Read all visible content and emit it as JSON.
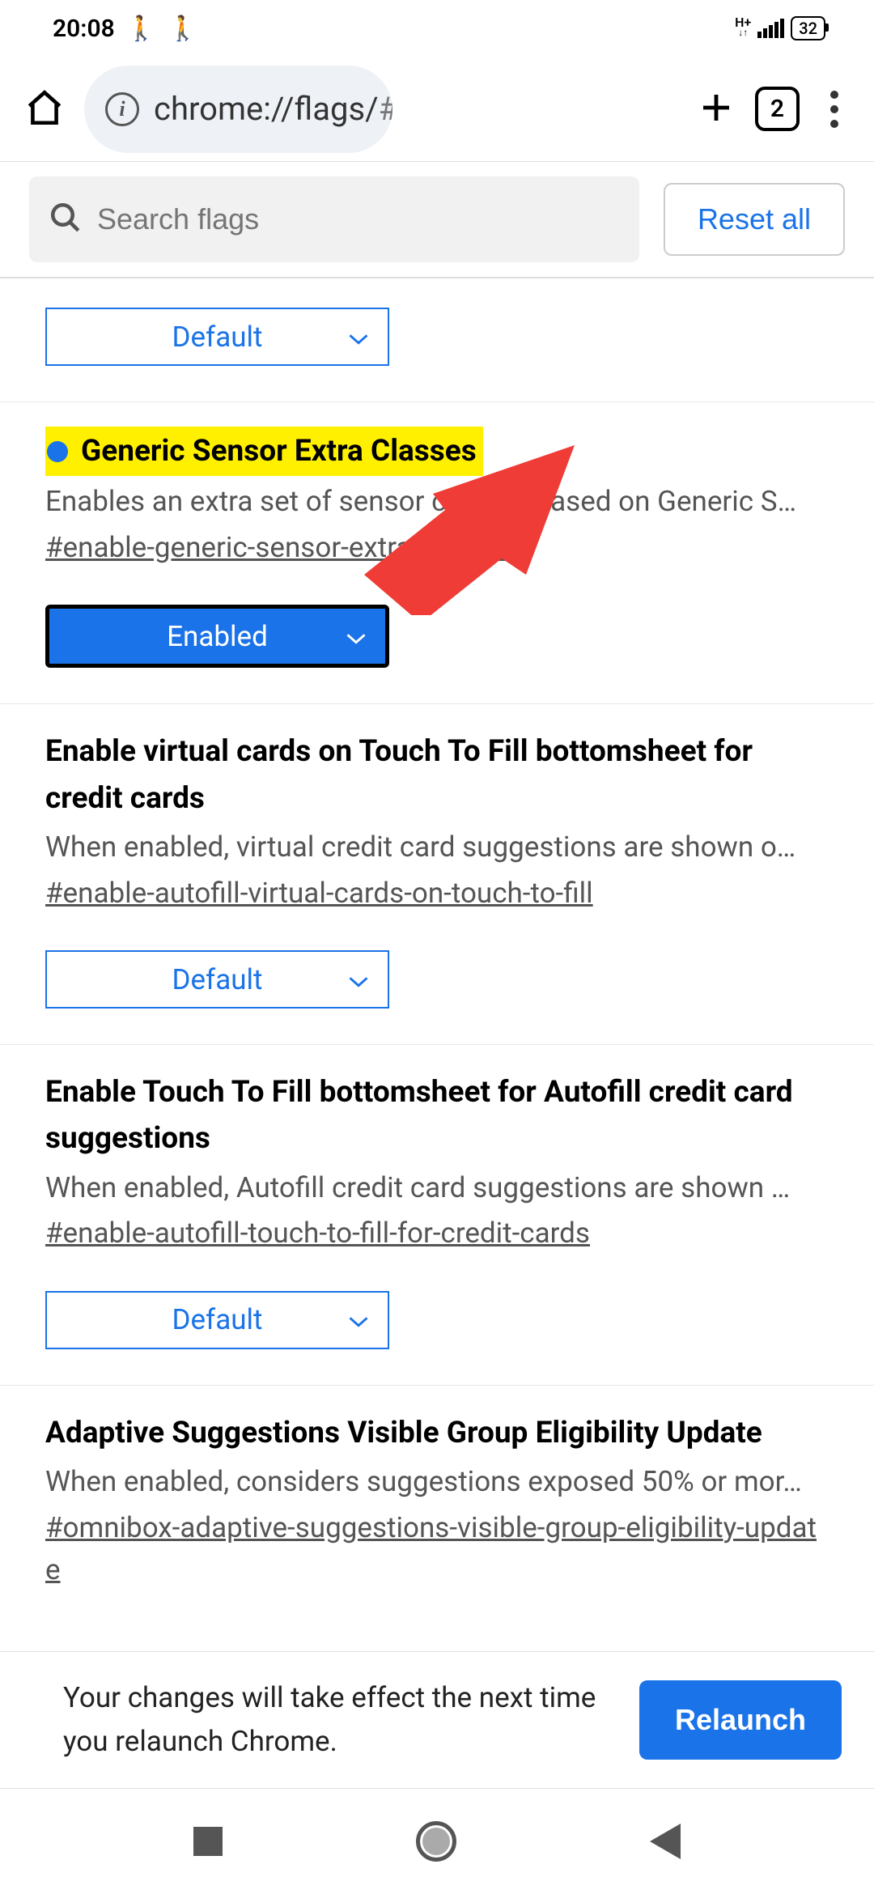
{
  "status": {
    "time": "20:08",
    "battery": "32"
  },
  "browser": {
    "url_prefix": "chrome://flags/",
    "url_hash": "#enab",
    "tab_count": "2"
  },
  "search": {
    "placeholder": "Search flags",
    "reset_label": "Reset all"
  },
  "flags": [
    {
      "picker_value": "Default"
    },
    {
      "title": "Generic Sensor Extra Classes",
      "desc": "Enables an extra set of sensor classes based on Generic S…",
      "hash": "#enable-generic-sensor-extra-classes",
      "picker_value": "Enabled"
    },
    {
      "title": "Enable virtual cards on Touch To Fill bottomsheet for credit cards",
      "desc": "When enabled, virtual credit card suggestions are shown o…",
      "hash": "#enable-autofill-virtual-cards-on-touch-to-fill",
      "picker_value": "Default"
    },
    {
      "title": "Enable Touch To Fill bottomsheet for Autofill credit card suggestions",
      "desc": "When enabled, Autofill credit card suggestions are shown …",
      "hash": "#enable-autofill-touch-to-fill-for-credit-cards",
      "picker_value": "Default"
    },
    {
      "title": "Adaptive Suggestions Visible Group Eligibility Update",
      "desc": "When enabled, considers suggestions exposed 50% or mor…",
      "hash": "#omnibox-adaptive-suggestions-visible-group-eligibility-update"
    }
  ],
  "relaunch": {
    "text": "Your changes will take effect the next time you relaunch Chrome.",
    "button": "Relaunch"
  }
}
